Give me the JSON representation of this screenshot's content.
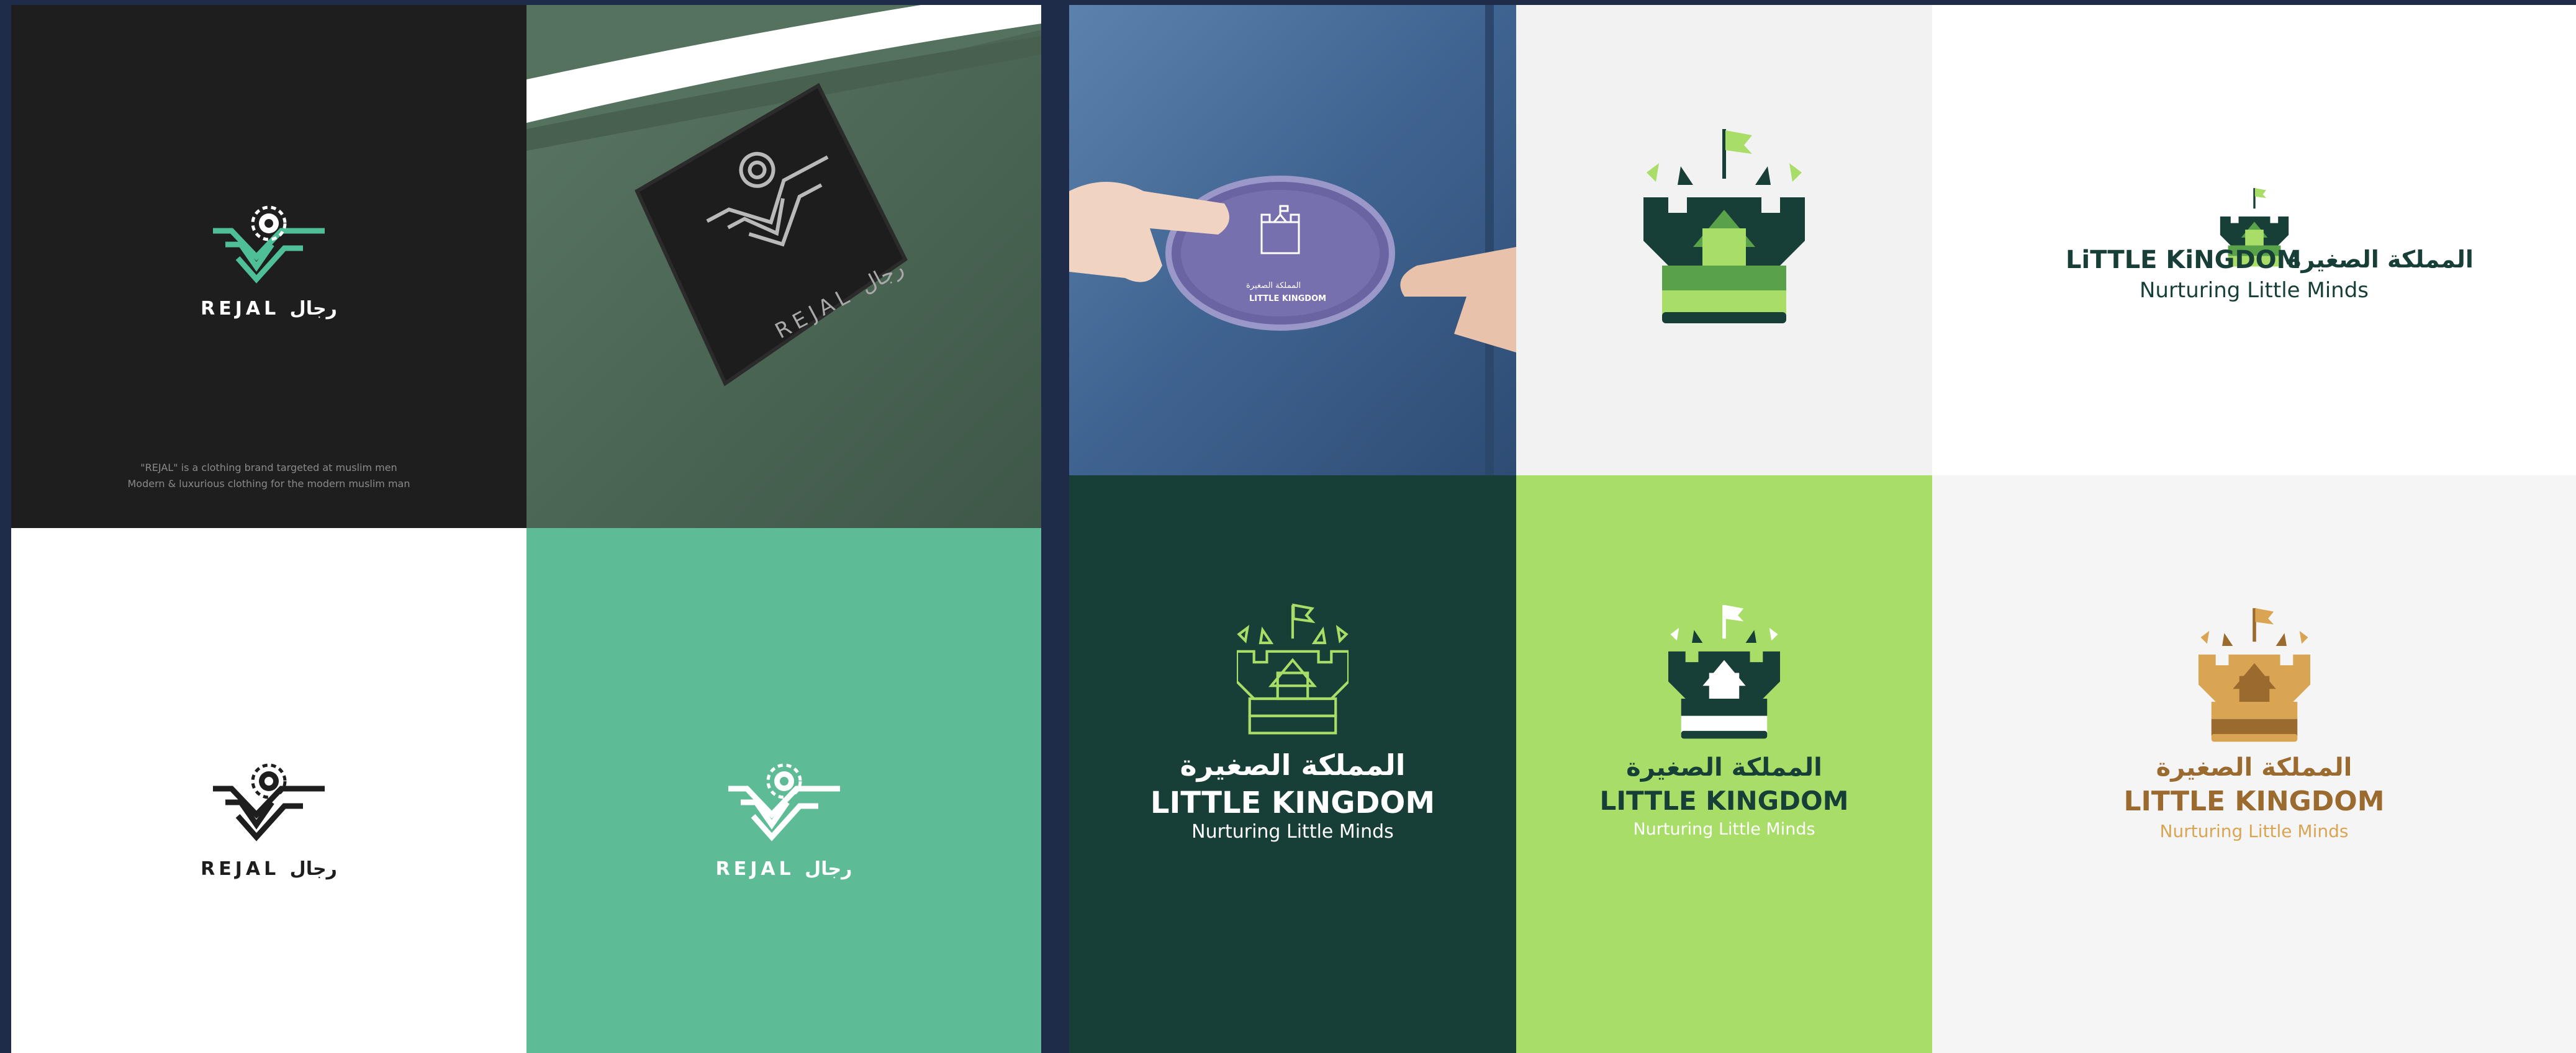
{
  "rejal": {
    "wordmark": "REJAL رجال",
    "tagline_line1": "\"REJAL\" is a clothing brand targeted at muslim men",
    "tagline_line2": "Modern & luxurious clothing for the modern muslim man",
    "label_text": "REJAL رجال"
  },
  "kingdom": {
    "arabic": "المملكة الصغيرة",
    "english": "LITTLE KINGDOM",
    "english_inline": "LiTTLE KiNGDOM",
    "tagline": "Nurturing Little Minds",
    "patch_arabic": "المملكة الصغيرة",
    "patch_english": "LITTLE KINGDOM"
  },
  "colors": {
    "background": "#1e2c4a",
    "rejal_dark": "#1e1e1e",
    "rejal_mint": "#5dbb96",
    "rejal_teal_mark": "#4fbf98",
    "kingdom_dark_green": "#173f37",
    "kingdom_lime": "#a8dd68",
    "kingdom_light_grey": "#f2f2f2",
    "kingdom_gold": "#d9a553",
    "kingdom_brown": "#9a6a2e",
    "shirt_green": "#4e6a58",
    "denim": "#4a6f9a",
    "patch_purple": "#7670ae"
  }
}
